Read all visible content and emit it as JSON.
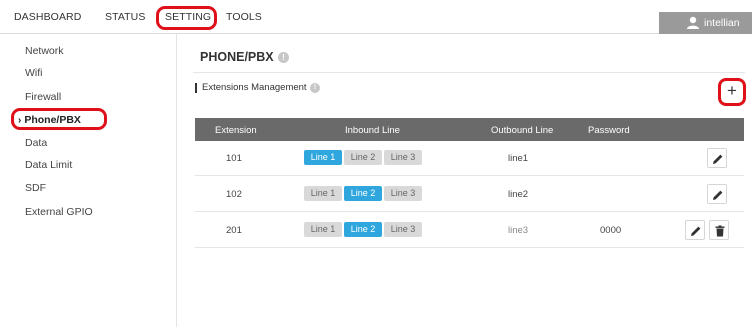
{
  "nav": {
    "tabs": [
      {
        "label": "DASHBOARD"
      },
      {
        "label": "STATUS"
      },
      {
        "label": "SETTING",
        "active": true
      },
      {
        "label": "TOOLS"
      }
    ],
    "user": {
      "name": "intellian",
      "icon": "user-icon"
    }
  },
  "sidebar": {
    "items": [
      {
        "label": "Network"
      },
      {
        "label": "Wifi"
      },
      {
        "label": "Firewall"
      },
      {
        "label": "Phone/PBX",
        "active": true
      },
      {
        "label": "Data"
      },
      {
        "label": "Data Limit"
      },
      {
        "label": "SDF"
      },
      {
        "label": "External GPIO"
      }
    ],
    "active_marker": "›"
  },
  "page": {
    "title": "PHONE/PBX",
    "section_title": "Extensions Management",
    "add_label": "+"
  },
  "table": {
    "headers": [
      "Extension",
      "Inbound Line",
      "Outbound Line",
      "Password"
    ],
    "line_labels": [
      "Line 1",
      "Line 2",
      "Line 3"
    ],
    "rows": [
      {
        "extension": "101",
        "active_line": 1,
        "outbound": "line1",
        "password": ""
      },
      {
        "extension": "102",
        "active_line": 2,
        "outbound": "line2",
        "password": ""
      },
      {
        "extension": "201",
        "active_line": 2,
        "outbound": "line3",
        "password": "0000"
      }
    ]
  },
  "colors": {
    "accent": "#2fa6dd",
    "header_bg": "#6a6a6a",
    "highlight": "#e0101a",
    "user_bg": "#9a9a9a"
  }
}
